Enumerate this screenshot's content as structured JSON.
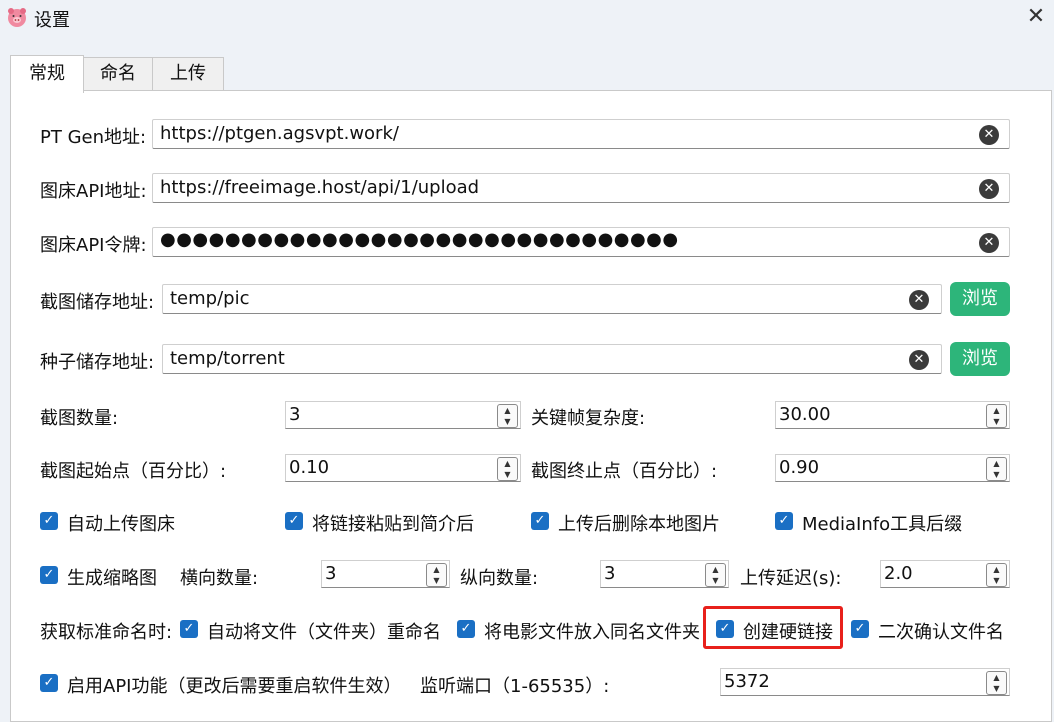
{
  "window": {
    "title": "设置",
    "icon": "pig-icon",
    "close_symbol": "✕"
  },
  "tabs": [
    {
      "label": "常规",
      "active": true
    },
    {
      "label": "命名",
      "active": false
    },
    {
      "label": "上传",
      "active": false
    }
  ],
  "fields": {
    "ptgen": {
      "label": "PT Gen地址:",
      "value": "https://ptgen.agsvpt.work/"
    },
    "imghost_api": {
      "label": "图床API地址:",
      "value": "https://freeimage.host/api/1/upload"
    },
    "imghost_token": {
      "label": "图床API令牌:",
      "masked": "●●●●●●●●●●●●●●●●●●●●●●●●●●●●●●●●"
    },
    "screenshot_path": {
      "label": "截图储存地址:",
      "value": "temp/pic",
      "browse": "浏览"
    },
    "torrent_path": {
      "label": "种子储存地址:",
      "value": "temp/torrent",
      "browse": "浏览"
    }
  },
  "spins": {
    "screenshot_count": {
      "label": "截图数量:",
      "value": "3"
    },
    "keyframe_complexity": {
      "label": "关键帧复杂度:",
      "value": "30.00"
    },
    "start_point": {
      "label": "截图起始点（百分比）:",
      "value": "0.10"
    },
    "end_point": {
      "label": "截图终止点（百分比）:",
      "value": "0.90"
    },
    "horizontal_count": {
      "label": "横向数量:",
      "value": "3"
    },
    "vertical_count": {
      "label": "纵向数量:",
      "value": "3"
    },
    "upload_delay": {
      "label": "上传延迟(s):",
      "value": "2.0"
    },
    "listen_port": {
      "label": "监听端口（1-65535）:",
      "value": "5372"
    }
  },
  "checkboxes": {
    "auto_upload": {
      "label": "自动上传图床",
      "checked": true
    },
    "paste_link": {
      "label": "将链接粘贴到简介后",
      "checked": true
    },
    "delete_local": {
      "label": "上传后删除本地图片",
      "checked": true
    },
    "mediainfo_suffix": {
      "label": "MediaInfo工具后缀",
      "checked": true
    },
    "thumbnail": {
      "label": "生成缩略图",
      "checked": true
    },
    "auto_rename": {
      "label": "自动将文件（文件夹）重命名",
      "checked": true
    },
    "movie_folder": {
      "label": "将电影文件放入同名文件夹",
      "checked": true
    },
    "hardlink": {
      "label": "创建硬链接",
      "checked": true
    },
    "confirm_name": {
      "label": "二次确认文件名",
      "checked": true
    },
    "enable_api": {
      "label": "启用API功能（更改后需要重启软件生效）",
      "checked": true
    }
  },
  "naming_label": "获取标准命名时:",
  "symbols": {
    "check": "✓",
    "clear": "✕",
    "up": "▲",
    "down": "▼"
  },
  "colors": {
    "accent": "#1a6fc4",
    "browse_button": "#2db57a",
    "highlight_box": "#e8201b"
  }
}
